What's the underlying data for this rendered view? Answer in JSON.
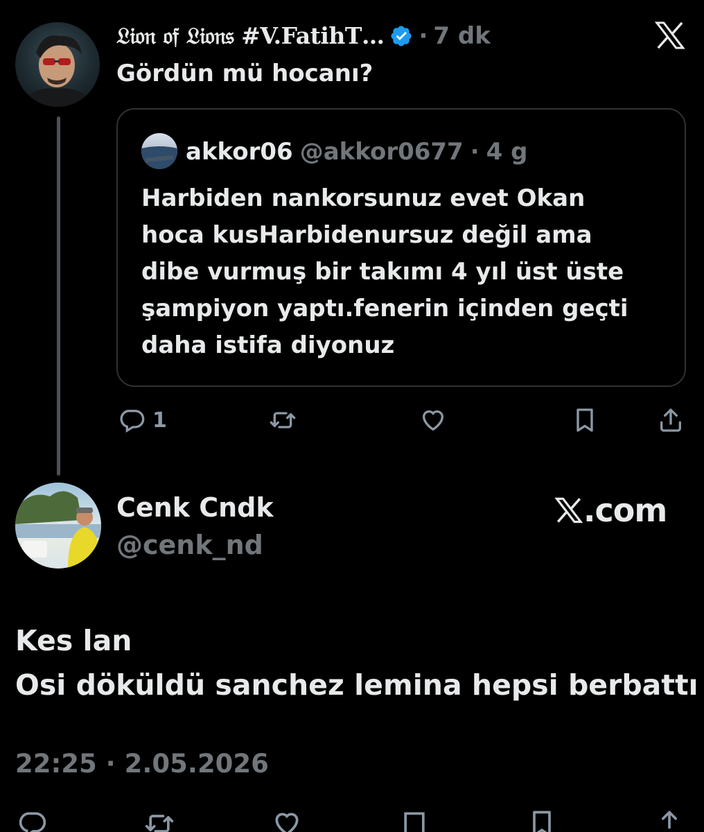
{
  "tweet": {
    "author_display_name": "𝔏𝔦𝔬𝔫 𝔬𝔣 𝔏𝔦𝔬𝔫𝔰 #V.FatihT…",
    "separator": "·",
    "time_ago": "7 dk",
    "text": "Gördün mü hocanı?",
    "verified": true,
    "verified_color": "#1d9bf0",
    "platform_icon": "x-logo-icon"
  },
  "quoted_tweet": {
    "display_name": "akkor06",
    "handle": "@akkor0677",
    "separator": "·",
    "time_ago": "4 g",
    "lines": [
      "Harbiden nankorsunuz evet Okan",
      "hoca kusHarbidenursuz değil ama",
      "dibe vurmuş bir takımı 4 yıl üst üste",
      "şampiyon yaptı.fenerin içinden geçti",
      "daha istifa diyonuz"
    ]
  },
  "actions": {
    "reply_count": "1",
    "icons": [
      "reply-icon",
      "retweet-icon",
      "like-icon",
      "bookmark-icon",
      "share-icon"
    ]
  },
  "reply": {
    "display_name": "Cenk Cndk",
    "handle": "@cenk_nd",
    "watermark_text": ".com",
    "watermark_icon": "x-logo-icon",
    "lines": [
      "Kes lan",
      "Osi döküldü sanchez lemina hepsi berbattı"
    ],
    "timestamp": "22:25 · 2.05.2026"
  },
  "colors": {
    "background": "#000000",
    "text_primary": "#e7e9ea",
    "text_secondary": "#71767b",
    "border": "#2f3336"
  }
}
